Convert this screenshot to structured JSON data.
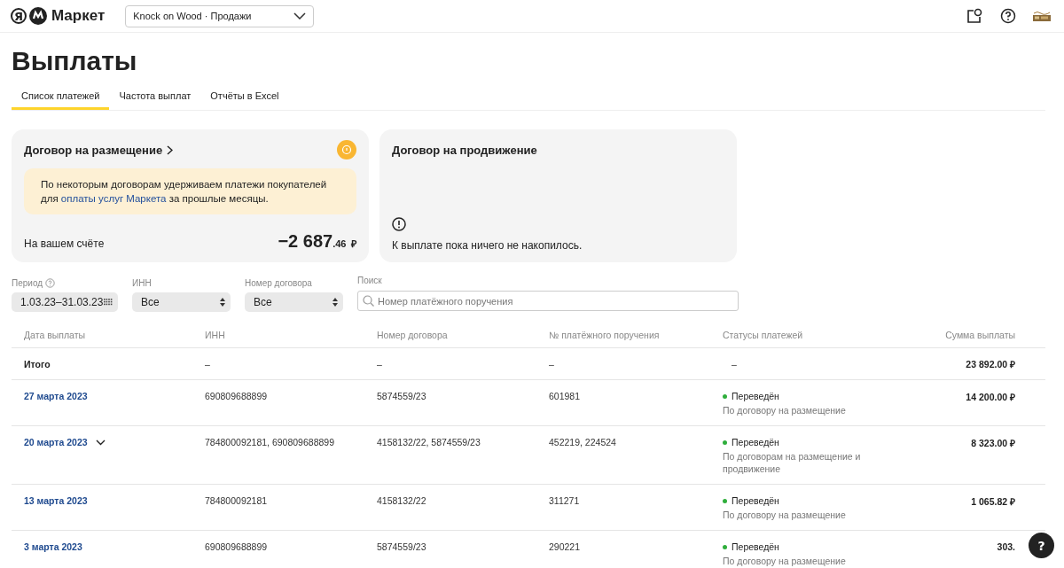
{
  "header": {
    "logo": {
      "mark": "Я",
      "name": "Маркет"
    },
    "store_select": {
      "value": "Knock on Wood · Продажи"
    }
  },
  "title": "Выплаты",
  "tabs": [
    {
      "label": "Список платежей",
      "selected": true
    },
    {
      "label": "Частота выплат",
      "selected": false
    },
    {
      "label": "Отчёты в Excel",
      "selected": false
    }
  ],
  "cards": [
    {
      "kind": "balance",
      "title": "Договор на размещение",
      "notice": {
        "before": "По некоторым договорам удерживаем платежи покупателей для ",
        "link": "оплаты услуг Маркета",
        "after": " за прошлые месяцы."
      },
      "label": "На вашем счёте",
      "amount": "−2 687",
      "cents": ".46",
      "currency": "₽"
    },
    {
      "kind": "empty",
      "title": "Договор на продвижение",
      "message": "К выплате пока ничего не накопилось."
    }
  ],
  "filters": [
    {
      "kind": "date",
      "label": "Период",
      "value": "1.03.23–31.03.23"
    },
    {
      "kind": "select",
      "label": "ИНН",
      "value": "Все"
    },
    {
      "kind": "select",
      "label": "Номер договора",
      "value": "Все"
    },
    {
      "kind": "search",
      "label": "Поиск",
      "placeholder": "Номер платёжного поручения"
    }
  ],
  "table": {
    "columns": [
      "Дата выплаты",
      "ИНН",
      "Номер договора",
      "№ платёжного поручения",
      "Статусы платежей",
      "Сумма выплаты"
    ],
    "rows": [
      {
        "kind": "total",
        "date": "Итого",
        "inn": "–",
        "contract": "–",
        "order": "–",
        "status": "–",
        "amount": "23 892.00 ₽"
      },
      {
        "kind": "payment",
        "date": "27 марта 2023",
        "expandable": false,
        "inn": "690809688899",
        "contract": "5874559/23",
        "order": "601981",
        "status": "Переведён",
        "color": "#2fae3c",
        "note": "По договору на размещение",
        "amount": "14 200.00 ₽"
      },
      {
        "kind": "payment",
        "date": "20 марта 2023",
        "expandable": true,
        "inn": "784800092181, 690809688899",
        "contract": "4158132/22, 5874559/23",
        "order": "452219, 224524",
        "status": "Переведён",
        "color": "#2fae3c",
        "note": "По договорам на размещение и продвижение",
        "amount": "8 323.00 ₽"
      },
      {
        "kind": "payment",
        "date": "13 марта 2023",
        "expandable": false,
        "inn": "784800092181",
        "contract": "4158132/22",
        "order": "311271",
        "status": "Переведён",
        "color": "#2fae3c",
        "note": "По договору на размещение",
        "amount": "1 065.82 ₽"
      },
      {
        "kind": "payment",
        "date": "3 марта 2023",
        "expandable": false,
        "inn": "690809688899",
        "contract": "5874559/23",
        "order": "290221",
        "status": "Переведён",
        "color": "#2fae3c",
        "note": "По договору на размещение",
        "amount": "303."
      }
    ]
  },
  "help_button": {
    "label": "?"
  }
}
